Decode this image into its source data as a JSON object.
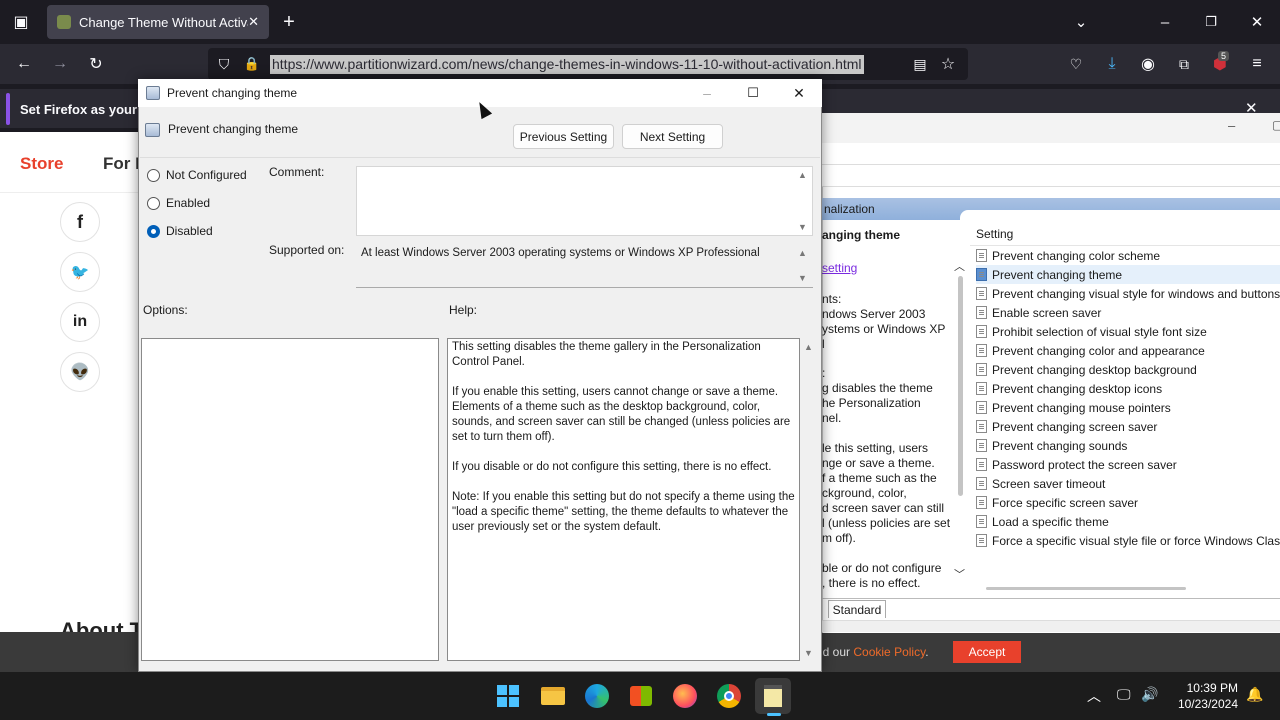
{
  "browser": {
    "tab_title": "Change Theme Without Activa",
    "url": "https://www.partitionwizard.com/news/change-themes-in-windows-11-10-without-activation.html",
    "notification": "Set Firefox as your de",
    "extension_badge": "5"
  },
  "website": {
    "nav_store": "Store",
    "nav_for": "For I",
    "about_heading": "About T",
    "cookie_text": "nd our",
    "cookie_link": "Cookie Policy",
    "cookie_period": ".",
    "accept_label": "Accept"
  },
  "gpedit_bg": {
    "band_label": "nalization",
    "policy_title": "anging theme",
    "edit_link": "setting",
    "fragments": [
      "nts:",
      "ndows Server 2003",
      "ystems or Windows XP",
      "l",
      ":",
      "g disables the theme",
      "he Personalization",
      "nel.",
      "le this setting, users",
      "nge or save a theme.",
      "f a theme such as the",
      "ckground, color,",
      "d screen saver can still",
      "l (unless policies are set",
      "m off).",
      "ble or do not configure",
      ", there is no effect."
    ],
    "list_header": "Setting",
    "settings": [
      "Prevent changing color scheme",
      "Prevent changing theme",
      "Prevent changing visual style for windows and buttons",
      "Enable screen saver",
      "Prohibit selection of visual style font size",
      "Prevent changing color and appearance",
      "Prevent changing desktop background",
      "Prevent changing desktop icons",
      "Prevent changing mouse pointers",
      "Prevent changing screen saver",
      "Prevent changing sounds",
      "Password protect the screen saver",
      "Screen saver timeout",
      "Force specific screen saver",
      "Load a specific theme",
      "Force a specific visual style file or force Windows Classi"
    ],
    "selected_index": 1,
    "view_tab": "Standard"
  },
  "dialog": {
    "window_title": "Prevent changing theme",
    "policy_name": "Prevent changing theme",
    "prev_button": "Previous Setting",
    "next_button": "Next Setting",
    "radio_options": [
      "Not Configured",
      "Enabled",
      "Disabled"
    ],
    "selected_option": "Disabled",
    "comment_label": "Comment:",
    "comment_value": "",
    "supported_label": "Supported on:",
    "supported_value": "At least Windows Server 2003 operating systems or Windows XP Professional",
    "options_label": "Options:",
    "help_label": "Help:",
    "help_paragraphs": [
      "This setting disables the theme gallery in the Personalization Control Panel.",
      "If you enable this setting, users cannot change or save a theme. Elements of a theme such as the desktop background, color, sounds, and screen saver can still be changed (unless policies are set to turn them off).",
      "If you disable or do not configure this setting, there is no effect.",
      "Note: If you enable this setting but do not specify a theme using the \"load a specific theme\" setting, the theme defaults to whatever the user previously set or the system default."
    ]
  },
  "taskbar": {
    "time": "10:39 PM",
    "date": "10/23/2024",
    "apps": [
      "start-icon",
      "file-explorer-icon",
      "edge-icon",
      "store-icon",
      "firefox-icon",
      "chrome-icon",
      "notepad-icon"
    ]
  },
  "colors": {
    "firefox_dark": "#1c1b22",
    "brand_red": "#e8412c",
    "radio_selected": "#005fb8",
    "gp_band": "#a9c1e3"
  }
}
